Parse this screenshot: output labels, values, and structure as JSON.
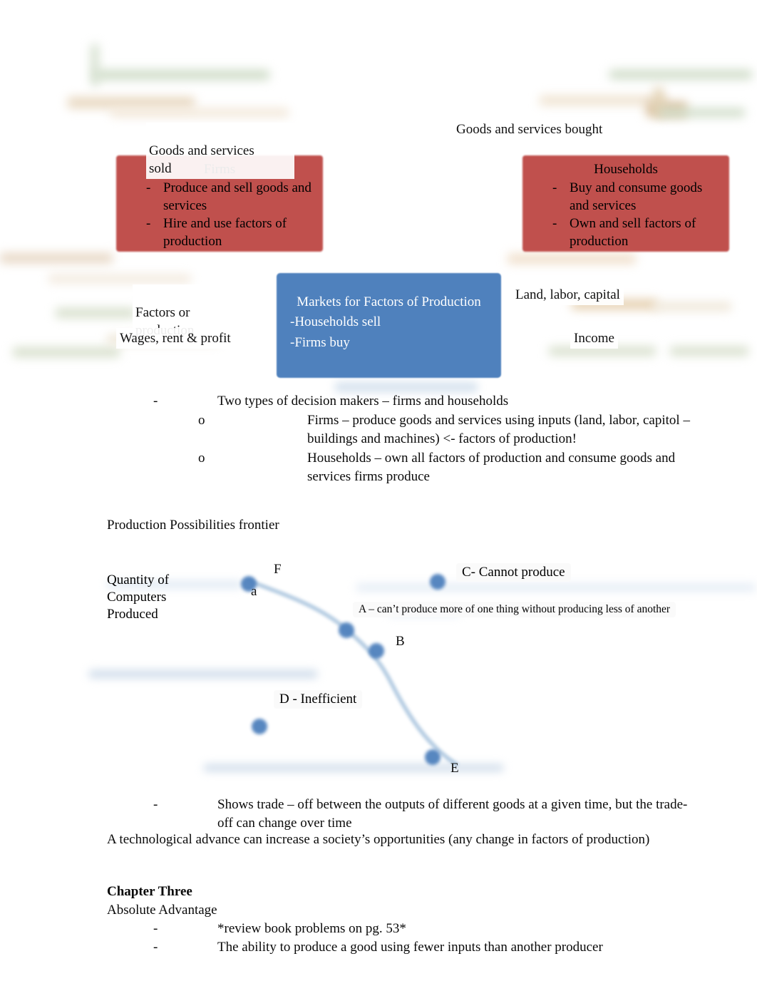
{
  "colors": {
    "firms_box": "#c0504d",
    "households_box": "#c0504d",
    "markets_box": "#4f81bd",
    "data_point": "#4f81bd"
  },
  "diagram": {
    "labels": {
      "goods_sold": "Goods and services\nsold",
      "goods_bought": "Goods and services bought",
      "factors_of_production": "Factors or\nproduction",
      "wages_rent_profit": "Wages, rent & profit",
      "land_labor_capital": "Land, labor, capital",
      "income": "Income"
    },
    "firms_box": {
      "title": "Firms",
      "bullets": [
        "Produce and sell goods and services",
        "Hire and use factors of production"
      ]
    },
    "households_box": {
      "title": "Households",
      "bullets": [
        "Buy and consume goods and services",
        "Own and sell factors of production"
      ]
    },
    "markets_box": {
      "title": "Markets for Factors of Production",
      "lines": [
        "-Households sell",
        "-Firms buy"
      ]
    }
  },
  "notes": {
    "decision_makers": "Two types of decision makers – firms and households",
    "sub_firms": "Firms – produce goods and services using inputs (land, labor, capitol – buildings and machines) <- factors of production!",
    "sub_households": "Households – own all factors of production and consume goods and services firms produce",
    "ppf_heading": "Production Possibilities frontier",
    "tradeoff_bullet": "Shows trade – off between the outputs of different goods at a given time, but the trade-off can change over time",
    "tech_advance": "A technological advance can increase a society’s opportunities (any change in factors of production)"
  },
  "chapter_three": {
    "heading": "Chapter Three",
    "subheading": "Absolute Advantage",
    "bullets": [
      "*review book problems on pg. 53*",
      "The ability to produce a good using fewer inputs than another producer"
    ]
  },
  "chart_data": {
    "type": "scatter",
    "title": "Production Possibilities frontier",
    "ylabel": "Quantity of Computers Produced",
    "xlabel": "",
    "grid": false,
    "legend": null,
    "points": [
      {
        "label": "a",
        "x": 0.12,
        "y": 0.92,
        "note": "on frontier"
      },
      {
        "label": "F",
        "x": 0.18,
        "y": 0.98,
        "note": "frontier point label"
      },
      {
        "label": "A",
        "x": 0.37,
        "y": 0.72,
        "note": "on frontier"
      },
      {
        "label": "B",
        "x": 0.42,
        "y": 0.64,
        "note": "on frontier"
      },
      {
        "label": "C",
        "x": 0.67,
        "y": 0.93,
        "note": "outside frontier"
      },
      {
        "label": "D",
        "x": 0.24,
        "y": 0.33,
        "note": "inside frontier"
      },
      {
        "label": "E",
        "x": 0.5,
        "y": 0.13,
        "note": "on frontier"
      }
    ],
    "annotations": [
      {
        "text": "C- Cannot produce",
        "for": "C"
      },
      {
        "text": "A – can’t produce more of one thing without producing less of another",
        "for": "A"
      },
      {
        "text": "D - Inefficient",
        "for": "D"
      }
    ],
    "frontier_curve_description": "Concave-to-origin curve from upper-left (point a/F) through A and B, bending down to E at lower-right"
  }
}
